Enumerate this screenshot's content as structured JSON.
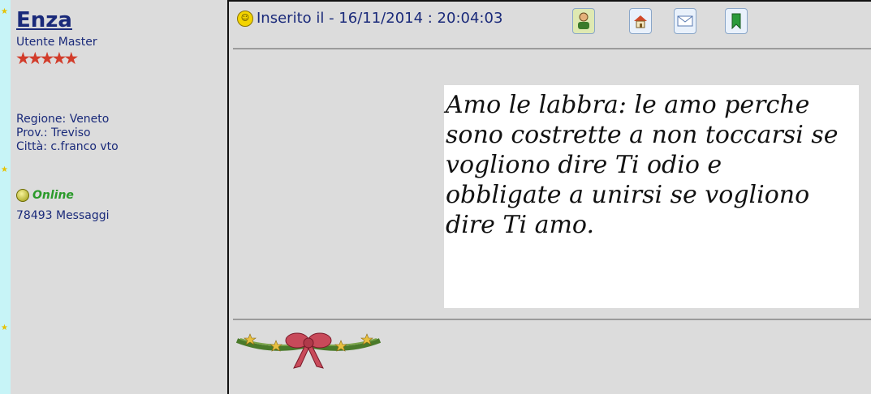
{
  "author": {
    "name": "Enza",
    "rank": "Utente Master",
    "rating_stars": 5
  },
  "profile": {
    "region": "Regione: Veneto",
    "province": "Prov.: Treviso",
    "city": "Città: c.franco vto"
  },
  "status": {
    "online": "Online",
    "messages": "78493 Messaggi"
  },
  "post": {
    "posted_label": "Inserito il - 16/11/2014 : 20:04:03",
    "quote_lines": [
      "Amo le labbra: le amo perche",
      "sono costrette a non toccarsi se",
      "vogliono dire Ti odio e",
      "obbligate a unirsi se vogliono",
      "dire Ti amo."
    ]
  },
  "icons": [
    "smiley-icon",
    "profile-icon",
    "homepage-icon",
    "email-icon",
    "bookmark-icon"
  ],
  "colors": {
    "side_strip": "#c7f4f7",
    "text_blue": "#1a2a7a",
    "star_red": "#d23c2a",
    "online_green": "#2a9a2a"
  }
}
